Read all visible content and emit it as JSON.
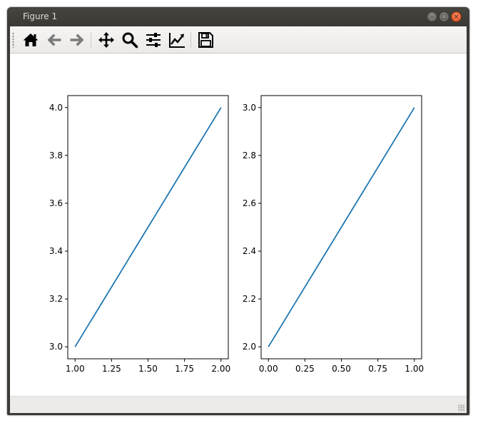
{
  "window": {
    "title": "Figure 1",
    "minimize_label": "–",
    "maximize_label": "□",
    "close_label": "×"
  },
  "toolbar": {
    "tools": [
      {
        "name": "home",
        "icon": "home-icon",
        "tooltip": "Reset original view"
      },
      {
        "name": "back",
        "icon": "arrow-left-icon",
        "tooltip": "Back to previous view"
      },
      {
        "name": "forward",
        "icon": "arrow-right-icon",
        "tooltip": "Forward to next view"
      },
      {
        "name": "pan",
        "icon": "move-arrows-icon",
        "tooltip": "Pan axes"
      },
      {
        "name": "zoom",
        "icon": "magnifier-icon",
        "tooltip": "Zoom to rectangle"
      },
      {
        "name": "subplots",
        "icon": "sliders-icon",
        "tooltip": "Configure subplots"
      },
      {
        "name": "customize",
        "icon": "line-chart-icon",
        "tooltip": "Edit axis, curve and image parameters"
      },
      {
        "name": "save",
        "icon": "floppy-disk-icon",
        "tooltip": "Save the figure"
      }
    ]
  },
  "status": {
    "text": ""
  },
  "colors": {
    "line": "#1f77b4",
    "axes": "#000000",
    "toolbar_icon": "#000000",
    "toolbar_icon_disabled": "#7a7a7a"
  },
  "chart_data": [
    {
      "type": "line",
      "title": "",
      "xlabel": "",
      "ylabel": "",
      "grid": false,
      "x": [
        1.0,
        2.0
      ],
      "series": [
        {
          "values": [
            3.0,
            4.0
          ]
        }
      ],
      "xlim": [
        0.95,
        2.05
      ],
      "ylim": [
        2.95,
        4.05
      ],
      "xticks": [
        1.0,
        1.25,
        1.5,
        1.75,
        2.0
      ],
      "xtick_labels": [
        "1.00",
        "1.25",
        "1.50",
        "1.75",
        "2.00"
      ],
      "yticks": [
        3.0,
        3.2,
        3.4,
        3.6,
        3.8,
        4.0
      ],
      "ytick_labels": [
        "3.0",
        "3.2",
        "3.4",
        "3.6",
        "3.8",
        "4.0"
      ]
    },
    {
      "type": "line",
      "title": "",
      "xlabel": "",
      "ylabel": "",
      "grid": false,
      "x": [
        0.0,
        1.0
      ],
      "series": [
        {
          "values": [
            2.0,
            3.0
          ]
        }
      ],
      "xlim": [
        -0.05,
        1.05
      ],
      "ylim": [
        1.95,
        3.05
      ],
      "xticks": [
        0.0,
        0.25,
        0.5,
        0.75,
        1.0
      ],
      "xtick_labels": [
        "0.00",
        "0.25",
        "0.50",
        "0.75",
        "1.00"
      ],
      "yticks": [
        2.0,
        2.2,
        2.4,
        2.6,
        2.8,
        3.0
      ],
      "ytick_labels": [
        "2.0",
        "2.2",
        "2.4",
        "2.6",
        "2.8",
        "3.0"
      ]
    }
  ]
}
